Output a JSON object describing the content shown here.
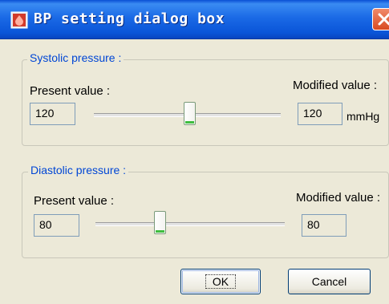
{
  "window": {
    "title": "BP setting dialog box"
  },
  "systolic": {
    "legend": "Systolic pressure :",
    "present_label": "Present value :",
    "modified_label": "Modified value :",
    "present_value": "120",
    "modified_value": "120",
    "unit": "mmHg",
    "slider_fraction": 0.51
  },
  "diastolic": {
    "legend": "Diastolic pressure :",
    "present_label": "Present value :",
    "modified_label": "Modified value :",
    "present_value": "80",
    "modified_value": "80",
    "slider_fraction": 0.34
  },
  "buttons": {
    "ok": "OK",
    "cancel": "Cancel"
  },
  "icons": {
    "title_icon": "bp-monitor-icon",
    "close": "close-icon"
  },
  "colors": {
    "legend_text": "#0046d5",
    "titlebar": "#0a55d8",
    "close_button": "#d84a22"
  }
}
